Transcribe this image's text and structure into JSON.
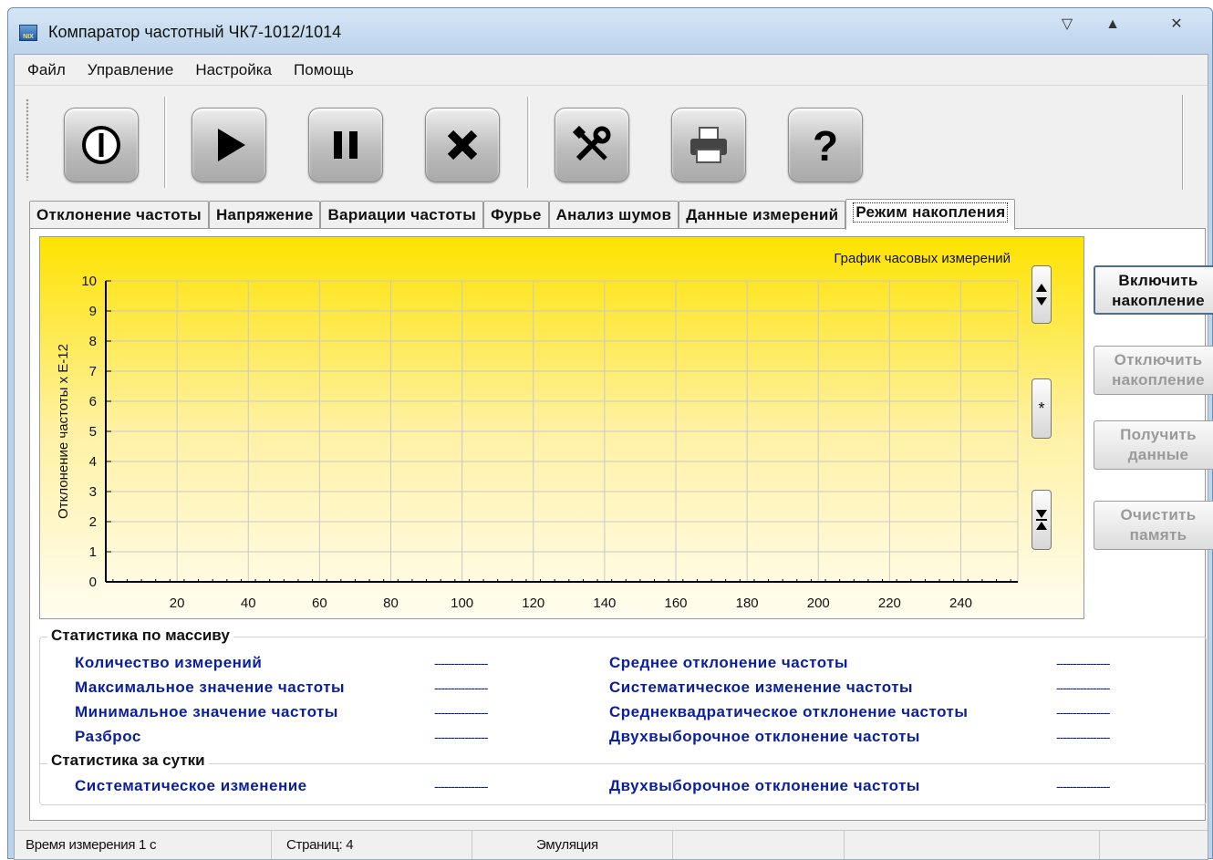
{
  "window": {
    "title": "Компаратор частотный ЧК7-1012/1014",
    "icon_text": "NIX"
  },
  "menu": [
    "Файл",
    "Управление",
    "Настройка",
    "Помощь"
  ],
  "toolbar": {
    "buttons": [
      {
        "icon": "power-icon"
      },
      {
        "icon": "play-icon"
      },
      {
        "icon": "pause-icon"
      },
      {
        "icon": "stop-x-icon"
      },
      {
        "icon": "tools-icon"
      },
      {
        "icon": "printer-icon"
      },
      {
        "icon": "help-icon",
        "glyph": "?"
      }
    ]
  },
  "tabs": [
    {
      "label": "Отклонение частоты"
    },
    {
      "label": "Напряжение"
    },
    {
      "label": "Вариации частоты"
    },
    {
      "label": "Фурье"
    },
    {
      "label": "Анализ шумов"
    },
    {
      "label": "Данные измерений"
    },
    {
      "label": "Режим накопления",
      "active": true
    }
  ],
  "chart_data": {
    "type": "line",
    "title": "График часовых измерений",
    "xlabel": "",
    "ylabel": "Отклонение частоты х Е-12",
    "xlim": [
      0,
      256
    ],
    "ylim": [
      0,
      10
    ],
    "xticks": [
      20,
      40,
      60,
      80,
      100,
      120,
      140,
      160,
      180,
      200,
      220,
      240
    ],
    "yticks": [
      0,
      1,
      2,
      3,
      4,
      5,
      6,
      7,
      8,
      9,
      10
    ],
    "grid": true,
    "series": []
  },
  "chart_controls": {
    "reset_glyph": "*"
  },
  "actions": {
    "enable": {
      "line1": "Включить",
      "line2": "накопление",
      "enabled": true
    },
    "disable": {
      "line1": "Отключить",
      "line2": "накопление",
      "enabled": false
    },
    "get": {
      "line1": "Получить",
      "line2": "данные",
      "enabled": false
    },
    "clear": {
      "line1": "Очистить",
      "line2": "память",
      "enabled": false
    }
  },
  "stats": {
    "array_title": "Статистика по массиву",
    "day_title": "Статистика за сутки",
    "placeholder": "----------------",
    "array_left": [
      "Количество измерений",
      "Максимальное значение частоты",
      "Минимальное значение частоты",
      "Разброс"
    ],
    "array_right": [
      "Среднее отклонение частоты",
      "Систематическое изменение частоты",
      "Среднеквадратическое отклонение частоты",
      "Двухвыборочное отклонение частоты"
    ],
    "day_left": "Систематическое изменение",
    "day_right": "Двухвыборочное отклонение частоты"
  },
  "status": {
    "time": "Время измерения 1 с",
    "pages": "Страниц: 4",
    "mode": "Эмуляция"
  }
}
